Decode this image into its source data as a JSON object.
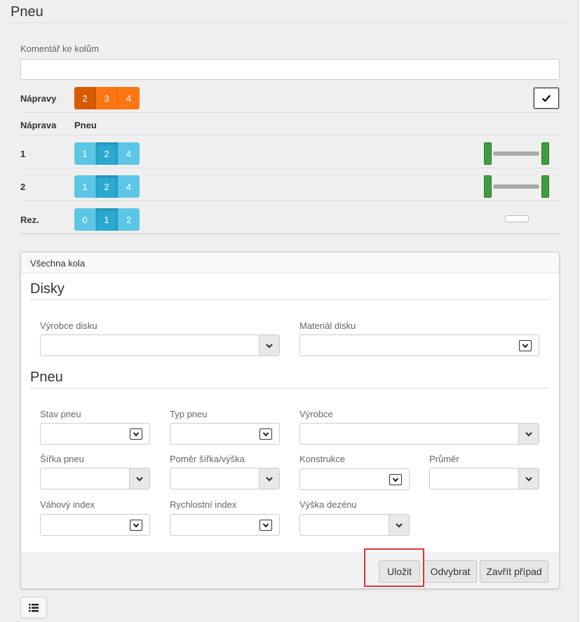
{
  "page": {
    "title": "Pneu"
  },
  "comment": {
    "label": "Komentář ke kolům",
    "value": ""
  },
  "axles": {
    "label": "Nápravy",
    "options": [
      "2",
      "3",
      "4"
    ],
    "selected": "2",
    "check_icon": "check-icon"
  },
  "table": {
    "col_axle": "Náprava",
    "col_tire": "Pneu",
    "rows": [
      {
        "label": "1",
        "options": [
          "1",
          "2",
          "4"
        ],
        "selected": "2"
      },
      {
        "label": "2",
        "options": [
          "1",
          "2",
          "4"
        ],
        "selected": "2"
      },
      {
        "label": "Rez.",
        "options": [
          "0",
          "1",
          "2"
        ],
        "selected": "1"
      }
    ]
  },
  "panel": {
    "title": "Všechna kola",
    "disks": {
      "title": "Disky",
      "manufacturer_label": "Výrobce disku",
      "material_label": "Materiál disku"
    },
    "tires": {
      "title": "Pneu",
      "state_label": "Stav pneu",
      "type_label": "Typ pneu",
      "manufacturer_label": "Výrobce",
      "width_label": "Šířka pneu",
      "ratio_label": "Poměr šířka/výška",
      "construction_label": "Konstrukce",
      "diameter_label": "Průměr",
      "load_label": "Váhový index",
      "speed_label": "Rychlostní index",
      "tread_label": "Výška dezénu"
    },
    "buttons": {
      "save": "Uložit",
      "remove": "Odvybrat",
      "close": "Zavřít případ"
    }
  },
  "colors": {
    "orange": "#ff7514",
    "orange_active": "#d95a00",
    "blue": "#5bc6e6",
    "blue_active": "#2aa9d1",
    "wheel_green": "#3f9d3f",
    "highlight": "#d9363e"
  }
}
